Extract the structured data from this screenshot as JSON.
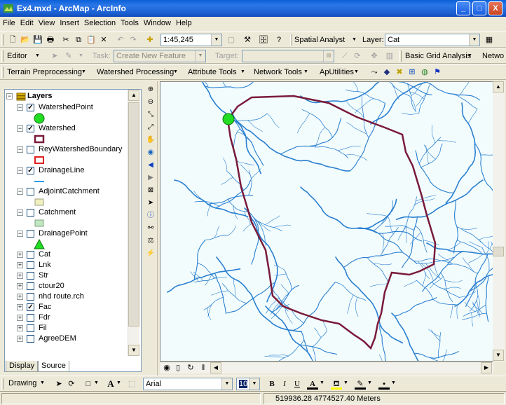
{
  "window": {
    "title": "Ex4.mxd - ArcMap - ArcInfo",
    "minimize": "_",
    "maximize": "□",
    "close": "X"
  },
  "menu": [
    "File",
    "Edit",
    "View",
    "Insert",
    "Selection",
    "Tools",
    "Window",
    "Help"
  ],
  "standard_toolbar": {
    "scale": "1:45,245",
    "spatial_analyst": "Spatial Analyst",
    "layer_label": "Layer:",
    "layer_value": "Cat"
  },
  "editor_toolbar": {
    "editor": "Editor",
    "task_label": "Task:",
    "task_value": "Create New Feature",
    "target_label": "Target:",
    "basic_grid": "Basic Grid Analysis",
    "network": "Netwo"
  },
  "hydro_toolbar": [
    "Terrain Preprocessing",
    "Watershed Processing",
    "Attribute Tools",
    "Network Tools",
    "ApUtilities"
  ],
  "toc": {
    "root": "Layers",
    "layers": [
      {
        "name": "WatershedPoint",
        "checked": true,
        "expanded": true,
        "symbol": "green-circle"
      },
      {
        "name": "Watershed",
        "checked": true,
        "expanded": true,
        "symbol": "maroon-rect"
      },
      {
        "name": "ReyWatershedBoundary",
        "checked": false,
        "expanded": true,
        "symbol": "red-rect"
      },
      {
        "name": "DrainageLine",
        "checked": true,
        "expanded": true,
        "symbol": "blue-line"
      },
      {
        "name": "AdjointCatchment",
        "checked": false,
        "expanded": true,
        "symbol": "yellow-rect"
      },
      {
        "name": "Catchment",
        "checked": false,
        "expanded": true,
        "symbol": "green-rect"
      },
      {
        "name": "DrainagePoint",
        "checked": false,
        "expanded": true,
        "symbol": "green-triangle"
      },
      {
        "name": "Cat",
        "checked": false,
        "expanded": false
      },
      {
        "name": "Lnk",
        "checked": false,
        "expanded": false
      },
      {
        "name": "Str",
        "checked": false,
        "expanded": false
      },
      {
        "name": "ctour20",
        "checked": false,
        "expanded": false
      },
      {
        "name": "nhd route.rch",
        "checked": false,
        "expanded": false
      },
      {
        "name": "Fac",
        "checked": true,
        "expanded": false
      },
      {
        "name": "Fdr",
        "checked": false,
        "expanded": false
      },
      {
        "name": "Fil",
        "checked": false,
        "expanded": false
      },
      {
        "name": "AgreeDEM",
        "checked": false,
        "expanded": false
      }
    ],
    "tabs": [
      "Display",
      "Source"
    ]
  },
  "drawing_toolbar": {
    "drawing": "Drawing",
    "font": "Arial",
    "size": "10",
    "bold": "B",
    "italic": "I",
    "underline": "U",
    "text_a": "A"
  },
  "status": {
    "coords": "519936.28  4774527.40 Meters"
  },
  "colors": {
    "watershed": "#7a1a3a",
    "streams": "#2a7fd0",
    "map_bg": "#f2fcfd",
    "point": "#22dd22"
  }
}
